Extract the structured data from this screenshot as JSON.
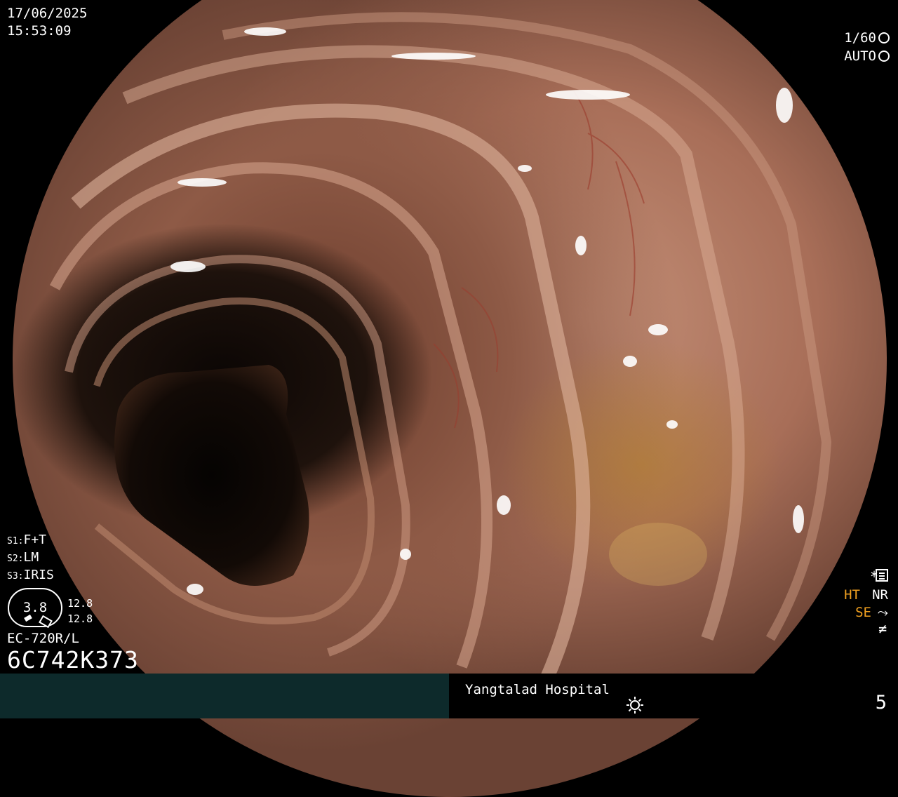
{
  "overlay": {
    "date": "17/06/2025",
    "time": "15:53:09",
    "shutter": "1/60",
    "shutter_icon": "aperture-icon",
    "mode": "AUTO",
    "mode_icon": "iris-icon",
    "s1_key": "S1:",
    "s1_val": "F+T",
    "s2_key": "S2:",
    "s2_val": "LM",
    "s3_key": "S3:",
    "s3_val": "IRIS",
    "gauge_value": "3.8",
    "gauge_side_1": "12.8",
    "gauge_side_2": "12.8",
    "scope_model": "EC-720R/L",
    "scope_serial": "6C742K373",
    "star": "*",
    "settings_icon": "settings-icon",
    "ht": "HT",
    "nr": "NR",
    "se": "SE",
    "se_icon": "curve-icon",
    "neq": "≠"
  },
  "footer": {
    "hospital": "Yangtalad Hospital",
    "light_icon": "sun-icon",
    "page": "5"
  },
  "colors": {
    "accent_orange": "#f0a020",
    "footer_left": "#0d2a2b",
    "text": "#ffffff"
  }
}
